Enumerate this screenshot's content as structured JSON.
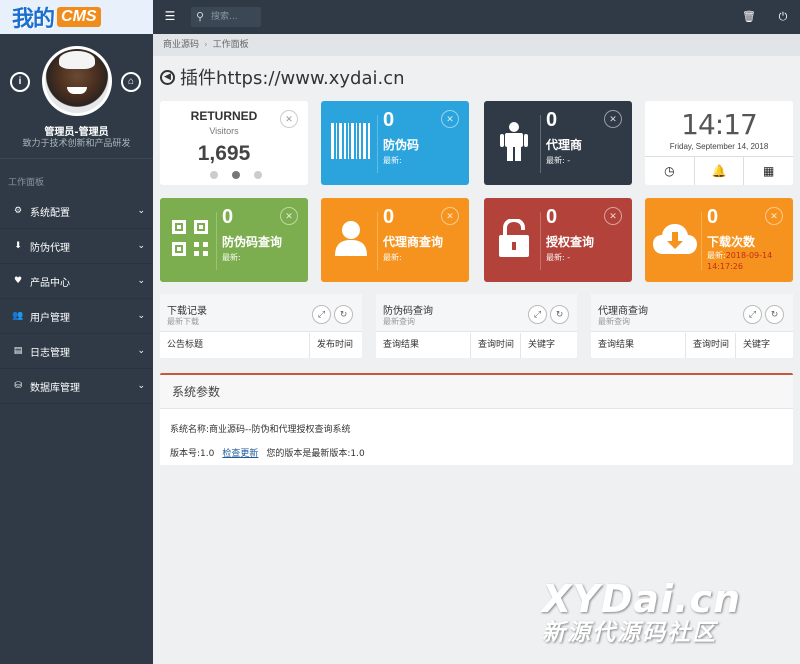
{
  "app": {
    "logo_part1": "我的",
    "logo_part2": "CMS"
  },
  "topbar": {
    "search_placeholder": "搜索..."
  },
  "sidebar": {
    "user_name": "管理员-管理员",
    "user_tagline": "致力于技术创新和产品研发",
    "section_label": "工作面板",
    "items": [
      {
        "label": "系统配置"
      },
      {
        "label": "防伪代理"
      },
      {
        "label": "产品中心"
      },
      {
        "label": "用户管理"
      },
      {
        "label": "日志管理"
      },
      {
        "label": "数据库管理"
      }
    ]
  },
  "breadcrumb": {
    "root": "商业源码",
    "current": "工作面板"
  },
  "page": {
    "title": "插件https://www.xydai.cn"
  },
  "tiles": {
    "returned": {
      "title": "RETURNED",
      "subtitle": "Visitors",
      "value": "1,695"
    },
    "fwm": {
      "value": "0",
      "label": "防伪码",
      "latest": "最新:"
    },
    "dls": {
      "value": "0",
      "label": "代理商",
      "latest": "最新: -"
    },
    "clock": {
      "time": "14:17",
      "date": "Friday, September 14, 2018"
    },
    "fwmcx": {
      "value": "0",
      "label": "防伪码查询",
      "latest": "最新:"
    },
    "dlscx": {
      "value": "0",
      "label": "代理商查询",
      "latest": "最新:"
    },
    "sqcx": {
      "value": "0",
      "label": "授权查询",
      "latest": "最新: -"
    },
    "xzcs": {
      "value": "0",
      "label": "下载次数",
      "latest_label": "最新:",
      "latest_value": "2018-09-14 14:17:26"
    }
  },
  "panels": [
    {
      "title": "下载记录",
      "subtitle": "最新下载",
      "columns": [
        "公告标题",
        "发布时间"
      ]
    },
    {
      "title": "防伪码查询",
      "subtitle": "最新查询",
      "columns": [
        "查询结果",
        "查询时间",
        "关键字"
      ]
    },
    {
      "title": "代理商查询",
      "subtitle": "最新查询",
      "columns": [
        "查询结果",
        "查询时间",
        "关键字"
      ]
    }
  ],
  "system": {
    "heading": "系统参数",
    "name_line": "系统名称:商业源码--防伪和代理授权查询系统",
    "version_label": "版本号:1.0",
    "check_update": "检查更新",
    "version_status": "您的版本是最新版本:1.0"
  },
  "watermark": {
    "line1": "XYDai.cn",
    "line2": "新源代源码社区"
  },
  "colors": {
    "blue": "#2ba4dd",
    "dark": "#2f3a46",
    "green": "#7cad4e",
    "orange": "#f6931e",
    "red": "#b2423a"
  }
}
